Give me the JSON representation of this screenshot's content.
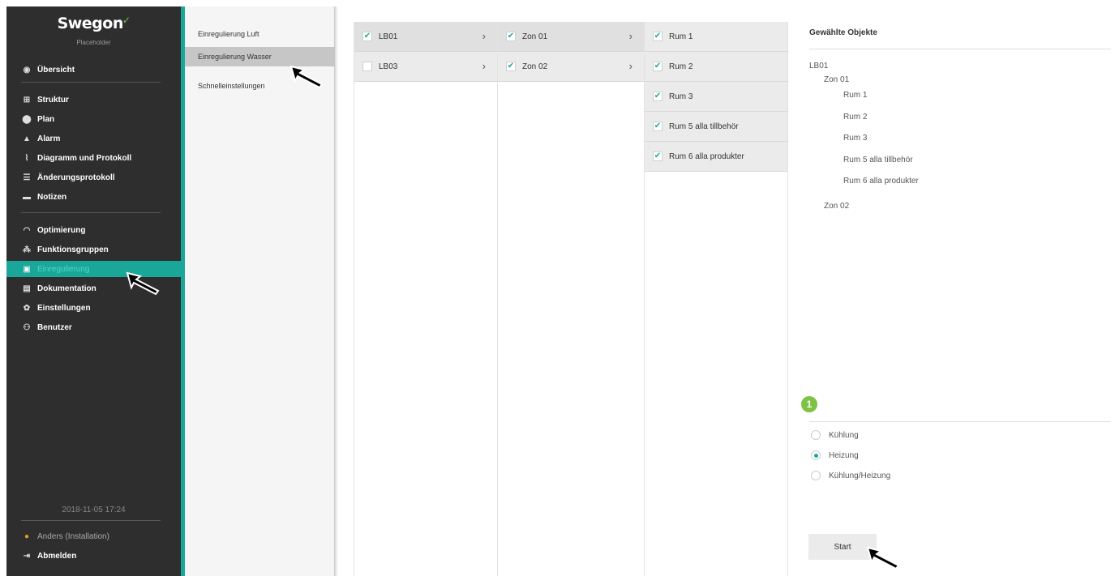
{
  "brand": {
    "name": "Swegon",
    "subtitle": "Placeholder"
  },
  "sidebar": {
    "items": [
      {
        "label": "Übersicht",
        "icon": "eye-icon"
      },
      {
        "label": "Struktur",
        "icon": "structure-icon"
      },
      {
        "label": "Plan",
        "icon": "map-pin-icon"
      },
      {
        "label": "Alarm",
        "icon": "bell-icon"
      },
      {
        "label": "Diagramm und Protokoll",
        "icon": "chart-icon"
      },
      {
        "label": "Änderungsprotokoll",
        "icon": "list-icon"
      },
      {
        "label": "Notizen",
        "icon": "note-icon"
      },
      {
        "label": "Optimierung",
        "icon": "gauge-icon"
      },
      {
        "label": "Funktionsgruppen",
        "icon": "group-icon"
      },
      {
        "label": "Einregulierung",
        "icon": "balance-icon",
        "active": true
      },
      {
        "label": "Dokumentation",
        "icon": "document-icon"
      },
      {
        "label": "Einstellungen",
        "icon": "gear-icon"
      },
      {
        "label": "Benutzer",
        "icon": "users-icon"
      }
    ],
    "timestamp": "2018-11-05 17:24",
    "user": "Anders (Installation)",
    "logout": "Abmelden"
  },
  "submenu": {
    "items": [
      {
        "label": "Einregulierung Luft"
      },
      {
        "label": "Einregulierung Wasser",
        "active": true
      },
      {
        "label": "Schnelleinstellungen"
      }
    ]
  },
  "columns": {
    "units": [
      {
        "label": "LB01",
        "checked": true
      },
      {
        "label": "LB03",
        "checked": false
      }
    ],
    "zones": [
      {
        "label": "Zon 01",
        "checked": true
      },
      {
        "label": "Zon 02",
        "checked": true
      }
    ],
    "rooms": [
      {
        "label": "Rum 1",
        "checked": true
      },
      {
        "label": "Rum 2",
        "checked": true
      },
      {
        "label": "Rum 3",
        "checked": true
      },
      {
        "label": "Rum 5 alla tillbehör",
        "checked": true
      },
      {
        "label": "Rum 6 alla produkter",
        "checked": true
      }
    ]
  },
  "selected_panel": {
    "title": "Gewählte Objekte",
    "tree": {
      "unit": "LB01",
      "zone1": "Zon 01",
      "rooms": [
        "Rum 1",
        "Rum 2",
        "Rum 3",
        "Rum 5 alla tillbehör",
        "Rum 6 alla produkter"
      ],
      "zone2": "Zon 02"
    },
    "step_badge": "1",
    "modes": [
      {
        "label": "Kühlung",
        "selected": false
      },
      {
        "label": "Heizung",
        "selected": true
      },
      {
        "label": "Kühlung/Heizung",
        "selected": false
      }
    ],
    "start_label": "Start"
  },
  "colors": {
    "accent": "#1aa79a",
    "sidebar_bg": "#2e2e2e",
    "badge": "#7dc242"
  }
}
